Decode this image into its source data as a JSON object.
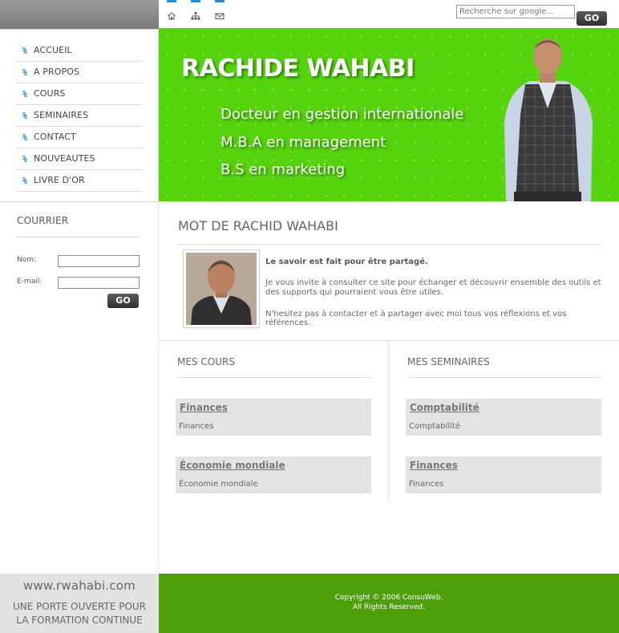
{
  "brand": {
    "name": "RACHIDE WAHABI",
    "credentials": [
      "Docteur en gestion internationale",
      "M.B.A en management",
      "B.S en marketing"
    ],
    "domain": "www.rwahabi.com",
    "tagline_line1": "UNE PORTE OUVERTE POUR",
    "tagline_line2": "LA FORMATION CONTINUE",
    "accent_green": "#55d40e",
    "footer_green": "#4f9f0a"
  },
  "topbar": {
    "icons": [
      "home-icon",
      "sitemap-icon",
      "mail-icon"
    ],
    "search_placeholder": "Recherche sur google...",
    "search_go": "GO"
  },
  "nav": {
    "items": [
      {
        "label": "ACCUEIL"
      },
      {
        "label": "A PROPOS"
      },
      {
        "label": "COURS"
      },
      {
        "label": "SEMINAIRES"
      },
      {
        "label": "CONTACT"
      },
      {
        "label": "NOUVEAUTES"
      },
      {
        "label": "LIVRE D'OR"
      }
    ]
  },
  "courrier": {
    "title": "COURRIER",
    "name_label": "Nom:",
    "email_label": "E-mail:",
    "go": "GO"
  },
  "mot": {
    "title": "MOT DE RACHID WAHABI",
    "bold": "Le savoir est fait pour être partagé.",
    "p1": "Je vous invite à consulter ce site pour échanger et découvrir ensemble des outils et des supports qui pourraient vous être utiles.",
    "p2": "N'hesitez pas à contacter et à partager avec moi tous vos réflexions et vos références."
  },
  "cours": {
    "title": "MES COURS",
    "items": [
      {
        "title": "Finances",
        "subtitle": "Finances"
      },
      {
        "title": "Économie mondiale",
        "subtitle": "Économie mondiale"
      }
    ]
  },
  "seminaires": {
    "title": "MES SEMINAIRES",
    "items": [
      {
        "title": "Comptabilité",
        "subtitle": "Comptabilité"
      },
      {
        "title": "Finances",
        "subtitle": "Finances"
      }
    ]
  },
  "footer": {
    "copyright_line1": "Copyright © 2006 ConsuWeb.",
    "copyright_line2": "All Rights Reserved."
  }
}
